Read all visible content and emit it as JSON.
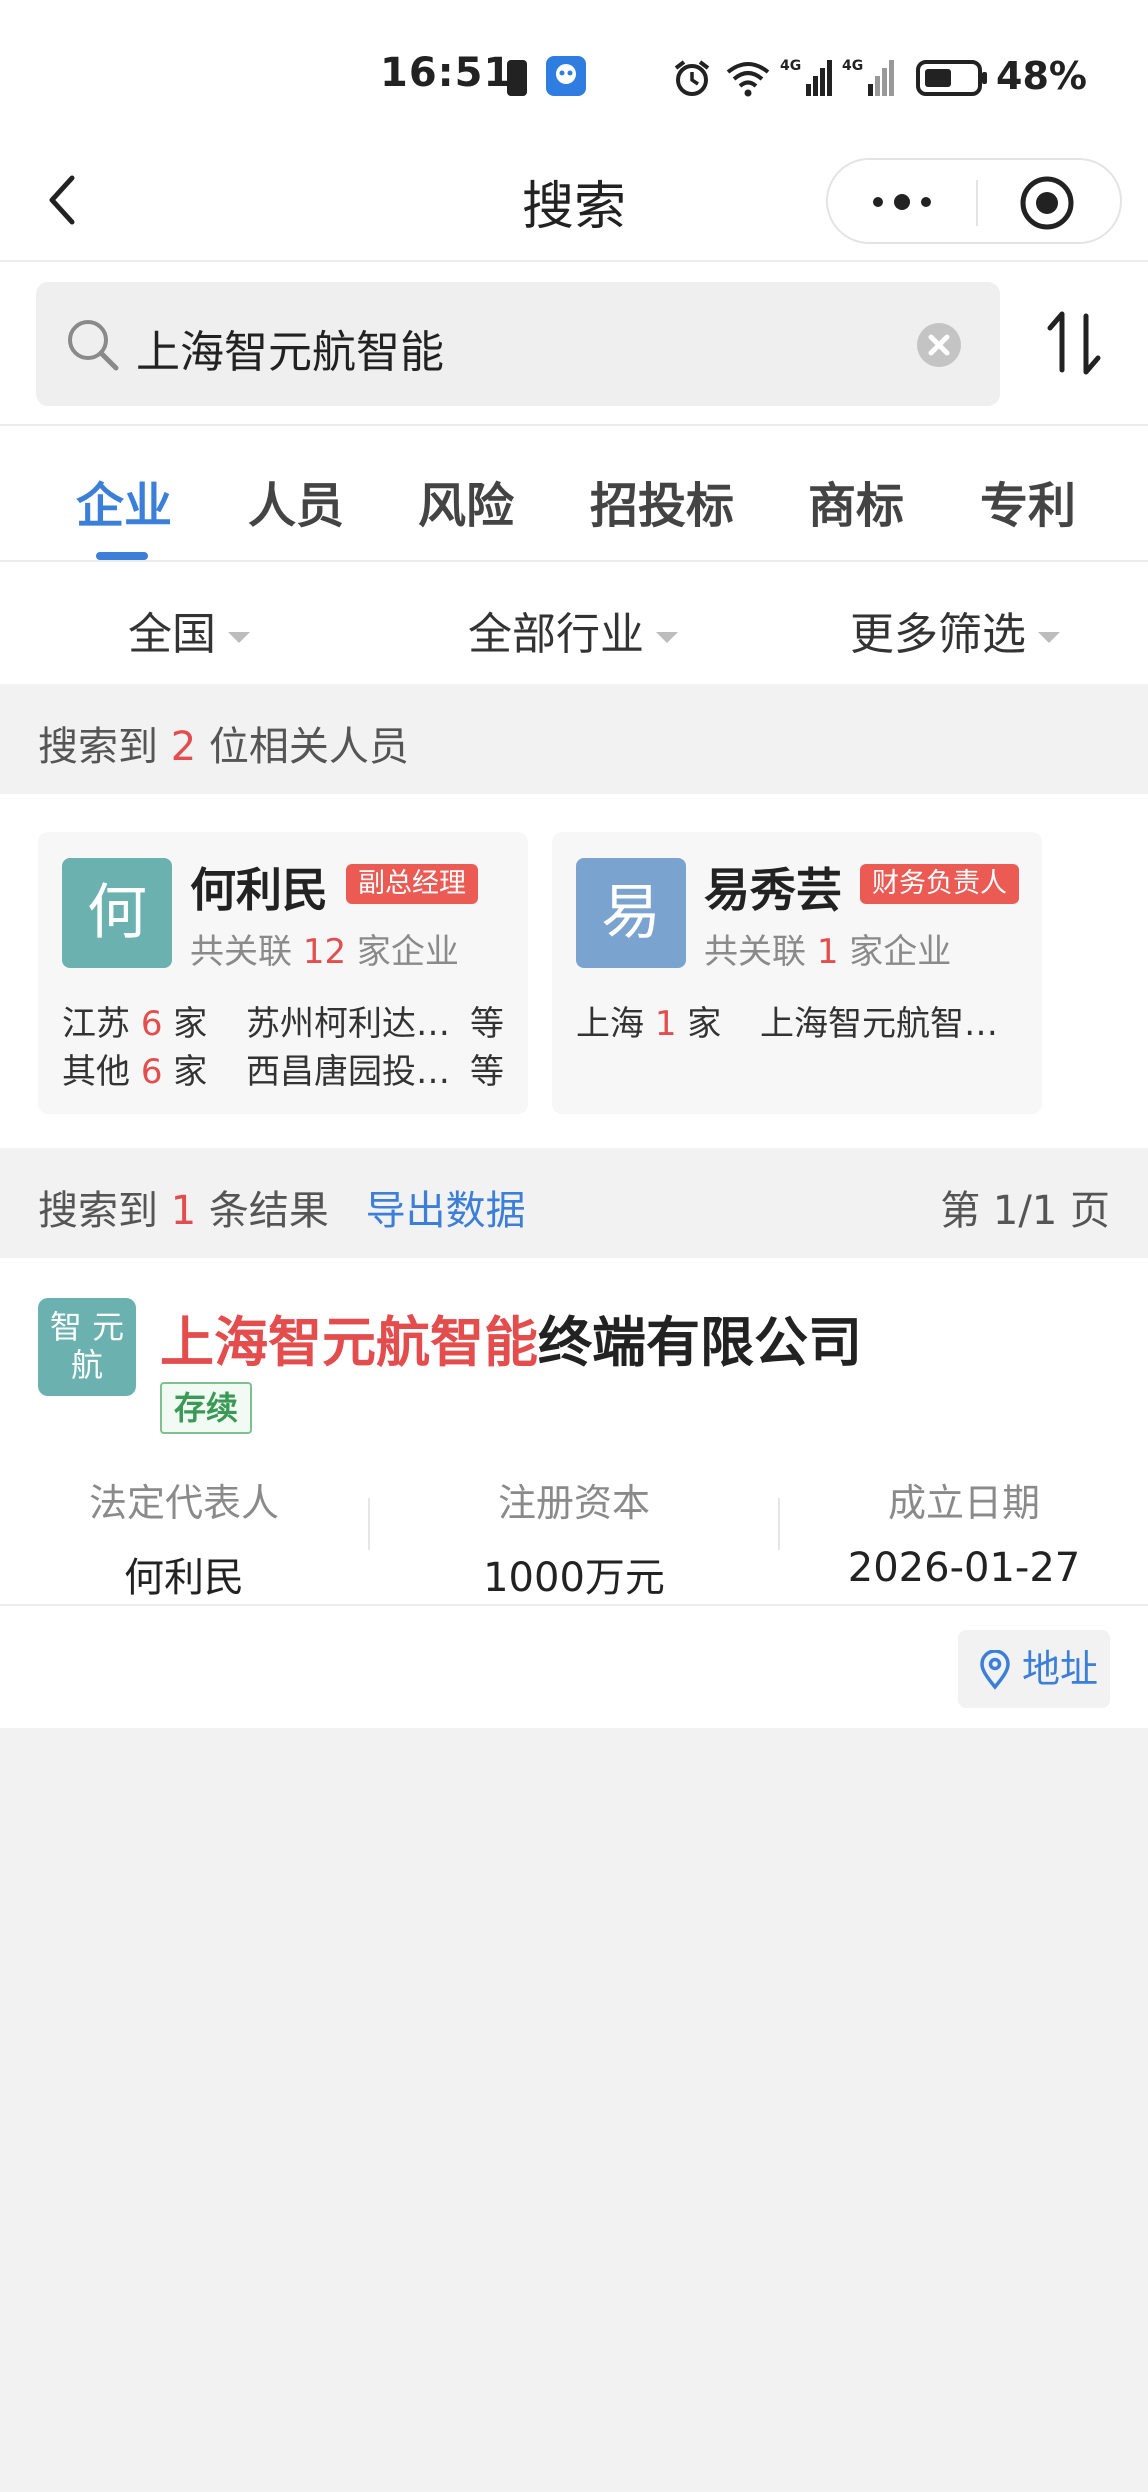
{
  "status_bar": {
    "time": "16:51",
    "battery_pct": "48%"
  },
  "nav": {
    "title": "搜索"
  },
  "search": {
    "value": "上海智元航智能"
  },
  "tabs": [
    {
      "label": "企业",
      "active": true
    },
    {
      "label": "人员"
    },
    {
      "label": "风险"
    },
    {
      "label": "招投标"
    },
    {
      "label": "商标"
    },
    {
      "label": "专利"
    }
  ],
  "filters": {
    "region": "全国",
    "industry": "全部行业",
    "more": "更多筛选"
  },
  "people_header": {
    "prefix": "搜索到",
    "count": "2",
    "suffix": "位相关人员"
  },
  "people": [
    {
      "avatar": "何",
      "avatar_color": "#6ab1b0",
      "name": "何利民",
      "tag": "副总经理",
      "count_prefix": "共关联",
      "count": "12",
      "count_suffix": "家企业",
      "rows": [
        {
          "region": "江苏",
          "num": "6",
          "unit": "家",
          "company": "苏州柯利达…",
          "etc": "等"
        },
        {
          "region": "其他",
          "num": "6",
          "unit": "家",
          "company": "西昌唐园投…",
          "etc": "等"
        }
      ]
    },
    {
      "avatar": "易",
      "avatar_color": "#7aa3cf",
      "name": "易秀芸",
      "tag": "财务负责人",
      "count_prefix": "共关联",
      "count": "1",
      "count_suffix": "家企业",
      "rows": [
        {
          "region": "上海",
          "num": "1",
          "unit": "家",
          "company": "上海智元航智…",
          "etc": ""
        }
      ]
    }
  ],
  "results_header": {
    "prefix": "搜索到",
    "count": "1",
    "suffix": "条结果",
    "export": "导出数据",
    "page": "第 1/1 页"
  },
  "result": {
    "logo_line1": "智 元",
    "logo_line2": "航",
    "name_highlight": "上海智元航智能",
    "name_rest": "终端有限公司",
    "status": "存续",
    "fields": [
      {
        "label": "法定代表人",
        "value": "何利民"
      },
      {
        "label": "注册资本",
        "value": "1000万元"
      },
      {
        "label": "成立日期",
        "value": "2026-01-27"
      }
    ],
    "address_btn": "地址"
  }
}
